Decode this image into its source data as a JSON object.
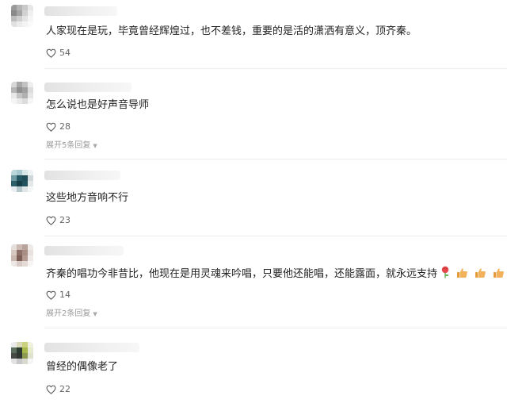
{
  "comments": [
    {
      "text": "人家现在是玩，毕竟曾经辉煌过，也不差钱，重要的是活的潇洒有意义，顶齐秦。",
      "likes": "54",
      "avatar_colors": [
        "#9a9a9a",
        "#b4b4b4",
        "#c9c9c9",
        "#e6e6e6",
        "#8a8a8a",
        "#a5a5a5",
        "#d2d2d2",
        "#f0f0f0",
        "#bdbdbd",
        "#cfcfcf",
        "#e4e4e4",
        "#f6f6f6",
        "#e0e0e0",
        "#ececec",
        "#f4f4f4",
        "#fafafa"
      ]
    },
    {
      "text": "怎么说也是好声音导师",
      "likes": "28",
      "expand": "展开5条回复",
      "avatar_colors": [
        "#d8d8d8",
        "#a7a7a7",
        "#c2c2c2",
        "#eeeeee",
        "#b6b6b6",
        "#8f8f8f",
        "#a0a0a0",
        "#dddddd",
        "#e8e8e8",
        "#c4c4c4",
        "#b0b0b0",
        "#e6e6e6",
        "#f4f4f4",
        "#e9e9e9",
        "#dcdcdc",
        "#f6f6f6"
      ]
    },
    {
      "text": "这些地方音响不行",
      "likes": "23",
      "avatar_colors": [
        "#bcd7dc",
        "#a6c8ce",
        "#d8e6e8",
        "#eef2f3",
        "#6f9aa2",
        "#245761",
        "#1f4d57",
        "#cfd9db",
        "#2c5f69",
        "#173f48",
        "#22525c",
        "#e3e8e9",
        "#e9eef0",
        "#b7c8cc",
        "#dfe6e8",
        "#f5f7f7"
      ]
    },
    {
      "text": "齐秦的唱功今非昔比，他现在是用灵魂来吟唱，只要他还能唱，还能露面，就永远支持",
      "likes": "14",
      "expand": "展开2条回复",
      "avatar_colors": [
        "#e5dedb",
        "#cbbab4",
        "#b8a39b",
        "#efe9e7",
        "#d7c8c2",
        "#8e6f67",
        "#a98d84",
        "#e9e1de",
        "#c9b6ae",
        "#7d5e56",
        "#b39990",
        "#f0ebe9",
        "#ede7e5",
        "#d9ccc7",
        "#e4dad6",
        "#f7f4f3"
      ]
    },
    {
      "text": "曾经的偶像老了",
      "likes": "22",
      "avatar_colors": [
        "#eaeaea",
        "#d7d9b9",
        "#cbd17e",
        "#f0f0e0",
        "#5c6f5c",
        "#2e3b31",
        "#a9b84d",
        "#e6ead0",
        "#454a44",
        "#303632",
        "#8c9a52",
        "#dfe2cf",
        "#e2e2e2",
        "#c8c8c8",
        "#d9d9d0",
        "#f5f5f5"
      ]
    }
  ],
  "emojis": [
    "rose",
    "thumbs-up",
    "thumbs-up",
    "thumbs-up"
  ],
  "colors": {
    "text": "#222222",
    "muted": "#9a9a9a",
    "divider": "#ececec",
    "rose": "#e8474c",
    "thumb": "#f2b25c"
  }
}
